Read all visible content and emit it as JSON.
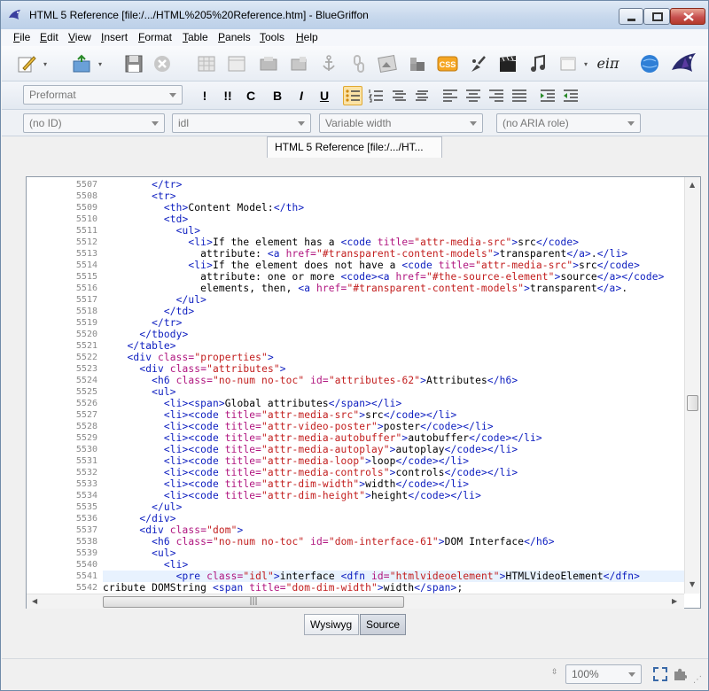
{
  "window": {
    "title": "HTML 5 Reference [file:/.../HTML%205%20Reference.htm] - BlueGriffon"
  },
  "menu": [
    "File",
    "Edit",
    "View",
    "Insert",
    "Format",
    "Table",
    "Panels",
    "Tools",
    "Help"
  ],
  "menu_mnemonic": [
    "F",
    "E",
    "V",
    "I",
    "F",
    "T",
    "P",
    "T",
    "H"
  ],
  "format_toolbar": {
    "paragraph_format": "Preformat",
    "buttons": {
      "emphasis1": "!",
      "emphasis2": "!!",
      "code": "C",
      "bold": "B",
      "italic": "I",
      "underline": "U"
    }
  },
  "attributes_bar": {
    "id": "(no ID)",
    "class": "idl",
    "width": "Variable width",
    "aria_role": "(no ARIA role)"
  },
  "document_tab": {
    "label": "HTML 5 Reference [file:/.../HT..."
  },
  "toolbar": {
    "css_label": "CSS",
    "math_label": "eiπ"
  },
  "editor": {
    "lines": [
      {
        "n": "5507",
        "segs": [
          [
            "x",
            "        "
          ],
          [
            "t",
            "</tr>"
          ]
        ]
      },
      {
        "n": "5508",
        "segs": [
          [
            "x",
            "        "
          ],
          [
            "t",
            "<tr>"
          ]
        ]
      },
      {
        "n": "5509",
        "segs": [
          [
            "x",
            "          "
          ],
          [
            "t",
            "<th>"
          ],
          [
            "x",
            "Content Model:"
          ],
          [
            "t",
            "</th>"
          ]
        ]
      },
      {
        "n": "5510",
        "segs": [
          [
            "x",
            "          "
          ],
          [
            "t",
            "<td>"
          ]
        ]
      },
      {
        "n": "5511",
        "segs": [
          [
            "x",
            "            "
          ],
          [
            "t",
            "<ul>"
          ]
        ]
      },
      {
        "n": "5512",
        "segs": [
          [
            "x",
            "              "
          ],
          [
            "t",
            "<li>"
          ],
          [
            "x",
            "If the element has a "
          ],
          [
            "t",
            "<code "
          ],
          [
            "a",
            "title="
          ],
          [
            "v",
            "\"attr-media-src\""
          ],
          [
            "t",
            ">"
          ],
          [
            "x",
            "src"
          ],
          [
            "t",
            "</code>"
          ]
        ]
      },
      {
        "n": "5513",
        "segs": [
          [
            "x",
            "                attribute: "
          ],
          [
            "t",
            "<a "
          ],
          [
            "a",
            "href="
          ],
          [
            "v",
            "\"#transparent-content-models\""
          ],
          [
            "t",
            ">"
          ],
          [
            "x",
            "transparent"
          ],
          [
            "t",
            "</a>"
          ],
          [
            "x",
            "."
          ],
          [
            "t",
            "</li>"
          ]
        ]
      },
      {
        "n": "5514",
        "segs": [
          [
            "x",
            "              "
          ],
          [
            "t",
            "<li>"
          ],
          [
            "x",
            "If the element does not have a "
          ],
          [
            "t",
            "<code "
          ],
          [
            "a",
            "title="
          ],
          [
            "v",
            "\"attr-media-src\""
          ],
          [
            "t",
            ">"
          ],
          [
            "x",
            "src"
          ],
          [
            "t",
            "</code>"
          ]
        ]
      },
      {
        "n": "5515",
        "segs": [
          [
            "x",
            "                attribute: one or more "
          ],
          [
            "t",
            "<code><a "
          ],
          [
            "a",
            "href="
          ],
          [
            "v",
            "\"#the-source-element\""
          ],
          [
            "t",
            ">"
          ],
          [
            "x",
            "source"
          ],
          [
            "t",
            "</a></code>"
          ]
        ]
      },
      {
        "n": "5516",
        "segs": [
          [
            "x",
            "                elements, then, "
          ],
          [
            "t",
            "<a "
          ],
          [
            "a",
            "href="
          ],
          [
            "v",
            "\"#transparent-content-models\""
          ],
          [
            "t",
            ">"
          ],
          [
            "x",
            "transparent"
          ],
          [
            "t",
            "</a>"
          ],
          [
            "x",
            "."
          ]
        ]
      },
      {
        "n": "5517",
        "segs": [
          [
            "x",
            "            "
          ],
          [
            "t",
            "</ul>"
          ]
        ]
      },
      {
        "n": "5518",
        "segs": [
          [
            "x",
            "          "
          ],
          [
            "t",
            "</td>"
          ]
        ]
      },
      {
        "n": "5519",
        "segs": [
          [
            "x",
            "        "
          ],
          [
            "t",
            "</tr>"
          ]
        ]
      },
      {
        "n": "5520",
        "segs": [
          [
            "x",
            "      "
          ],
          [
            "t",
            "</tbody>"
          ]
        ]
      },
      {
        "n": "5521",
        "segs": [
          [
            "x",
            "    "
          ],
          [
            "t",
            "</table>"
          ]
        ]
      },
      {
        "n": "5522",
        "segs": [
          [
            "x",
            "    "
          ],
          [
            "t",
            "<div "
          ],
          [
            "a",
            "class="
          ],
          [
            "v",
            "\"properties\""
          ],
          [
            "t",
            ">"
          ]
        ]
      },
      {
        "n": "5523",
        "segs": [
          [
            "x",
            "      "
          ],
          [
            "t",
            "<div "
          ],
          [
            "a",
            "class="
          ],
          [
            "v",
            "\"attributes\""
          ],
          [
            "t",
            ">"
          ]
        ]
      },
      {
        "n": "5524",
        "segs": [
          [
            "x",
            "        "
          ],
          [
            "t",
            "<h6 "
          ],
          [
            "a",
            "class="
          ],
          [
            "v",
            "\"no-num no-toc\" "
          ],
          [
            "a",
            "id="
          ],
          [
            "v",
            "\"attributes-62\""
          ],
          [
            "t",
            ">"
          ],
          [
            "x",
            "Attributes"
          ],
          [
            "t",
            "</h6>"
          ]
        ]
      },
      {
        "n": "5525",
        "segs": [
          [
            "x",
            "        "
          ],
          [
            "t",
            "<ul>"
          ]
        ]
      },
      {
        "n": "5526",
        "segs": [
          [
            "x",
            "          "
          ],
          [
            "t",
            "<li><span>"
          ],
          [
            "x",
            "Global attributes"
          ],
          [
            "t",
            "</span></li>"
          ]
        ]
      },
      {
        "n": "5527",
        "segs": [
          [
            "x",
            "          "
          ],
          [
            "t",
            "<li><code "
          ],
          [
            "a",
            "title="
          ],
          [
            "v",
            "\"attr-media-src\""
          ],
          [
            "t",
            ">"
          ],
          [
            "x",
            "src"
          ],
          [
            "t",
            "</code></li>"
          ]
        ]
      },
      {
        "n": "5528",
        "segs": [
          [
            "x",
            "          "
          ],
          [
            "t",
            "<li><code "
          ],
          [
            "a",
            "title="
          ],
          [
            "v",
            "\"attr-video-poster\""
          ],
          [
            "t",
            ">"
          ],
          [
            "x",
            "poster"
          ],
          [
            "t",
            "</code></li>"
          ]
        ]
      },
      {
        "n": "5529",
        "segs": [
          [
            "x",
            "          "
          ],
          [
            "t",
            "<li><code "
          ],
          [
            "a",
            "title="
          ],
          [
            "v",
            "\"attr-media-autobuffer\""
          ],
          [
            "t",
            ">"
          ],
          [
            "x",
            "autobuffer"
          ],
          [
            "t",
            "</code></li>"
          ]
        ]
      },
      {
        "n": "5530",
        "segs": [
          [
            "x",
            "          "
          ],
          [
            "t",
            "<li><code "
          ],
          [
            "a",
            "title="
          ],
          [
            "v",
            "\"attr-media-autoplay\""
          ],
          [
            "t",
            ">"
          ],
          [
            "x",
            "autoplay"
          ],
          [
            "t",
            "</code></li>"
          ]
        ]
      },
      {
        "n": "5531",
        "segs": [
          [
            "x",
            "          "
          ],
          [
            "t",
            "<li><code "
          ],
          [
            "a",
            "title="
          ],
          [
            "v",
            "\"attr-media-loop\""
          ],
          [
            "t",
            ">"
          ],
          [
            "x",
            "loop"
          ],
          [
            "t",
            "</code></li>"
          ]
        ]
      },
      {
        "n": "5532",
        "segs": [
          [
            "x",
            "          "
          ],
          [
            "t",
            "<li><code "
          ],
          [
            "a",
            "title="
          ],
          [
            "v",
            "\"attr-media-controls\""
          ],
          [
            "t",
            ">"
          ],
          [
            "x",
            "controls"
          ],
          [
            "t",
            "</code></li>"
          ]
        ]
      },
      {
        "n": "5533",
        "segs": [
          [
            "x",
            "          "
          ],
          [
            "t",
            "<li><code "
          ],
          [
            "a",
            "title="
          ],
          [
            "v",
            "\"attr-dim-width\""
          ],
          [
            "t",
            ">"
          ],
          [
            "x",
            "width"
          ],
          [
            "t",
            "</code></li>"
          ]
        ]
      },
      {
        "n": "5534",
        "segs": [
          [
            "x",
            "          "
          ],
          [
            "t",
            "<li><code "
          ],
          [
            "a",
            "title="
          ],
          [
            "v",
            "\"attr-dim-height\""
          ],
          [
            "t",
            ">"
          ],
          [
            "x",
            "height"
          ],
          [
            "t",
            "</code></li>"
          ]
        ]
      },
      {
        "n": "5535",
        "segs": [
          [
            "x",
            "        "
          ],
          [
            "t",
            "</ul>"
          ]
        ]
      },
      {
        "n": "5536",
        "segs": [
          [
            "x",
            "      "
          ],
          [
            "t",
            "</div>"
          ]
        ]
      },
      {
        "n": "5537",
        "segs": [
          [
            "x",
            "      "
          ],
          [
            "t",
            "<div "
          ],
          [
            "a",
            "class="
          ],
          [
            "v",
            "\"dom\""
          ],
          [
            "t",
            ">"
          ]
        ]
      },
      {
        "n": "5538",
        "segs": [
          [
            "x",
            "        "
          ],
          [
            "t",
            "<h6 "
          ],
          [
            "a",
            "class="
          ],
          [
            "v",
            "\"no-num no-toc\" "
          ],
          [
            "a",
            "id="
          ],
          [
            "v",
            "\"dom-interface-61\""
          ],
          [
            "t",
            ">"
          ],
          [
            "x",
            "DOM Interface"
          ],
          [
            "t",
            "</h6>"
          ]
        ]
      },
      {
        "n": "5539",
        "segs": [
          [
            "x",
            "        "
          ],
          [
            "t",
            "<ul>"
          ]
        ]
      },
      {
        "n": "5540",
        "segs": [
          [
            "x",
            "          "
          ],
          [
            "t",
            "<li>"
          ]
        ]
      },
      {
        "n": "5541",
        "segs": [
          [
            "x",
            "            "
          ],
          [
            "t",
            "<pre "
          ],
          [
            "a",
            "class="
          ],
          [
            "v",
            "\"idl\""
          ],
          [
            "t",
            ">"
          ],
          [
            "x",
            "interface "
          ],
          [
            "t",
            "<dfn "
          ],
          [
            "a",
            "id="
          ],
          [
            "v",
            "\"htmlvideoelement\""
          ],
          [
            "t",
            ">"
          ],
          [
            "x",
            "HTMLVideoElement"
          ],
          [
            "t",
            "</dfn>"
          ]
        ]
      },
      {
        "n": "5542",
        "segs": [
          [
            "x",
            "cribute DOMString "
          ],
          [
            "t",
            "<span "
          ],
          [
            "a",
            "title="
          ],
          [
            "v",
            "\"dom-dim-width\""
          ],
          [
            "t",
            ">"
          ],
          [
            "x",
            "width"
          ],
          [
            "t",
            "</span>"
          ],
          [
            "x",
            ";"
          ]
        ]
      }
    ]
  },
  "view_modes": {
    "wysiwyg": "Wysiwyg",
    "source": "Source"
  },
  "status": {
    "zoom": "100%"
  },
  "colors": {
    "tag": "#0b1cbf",
    "attr": "#b0157f",
    "value": "#c21d1d"
  }
}
